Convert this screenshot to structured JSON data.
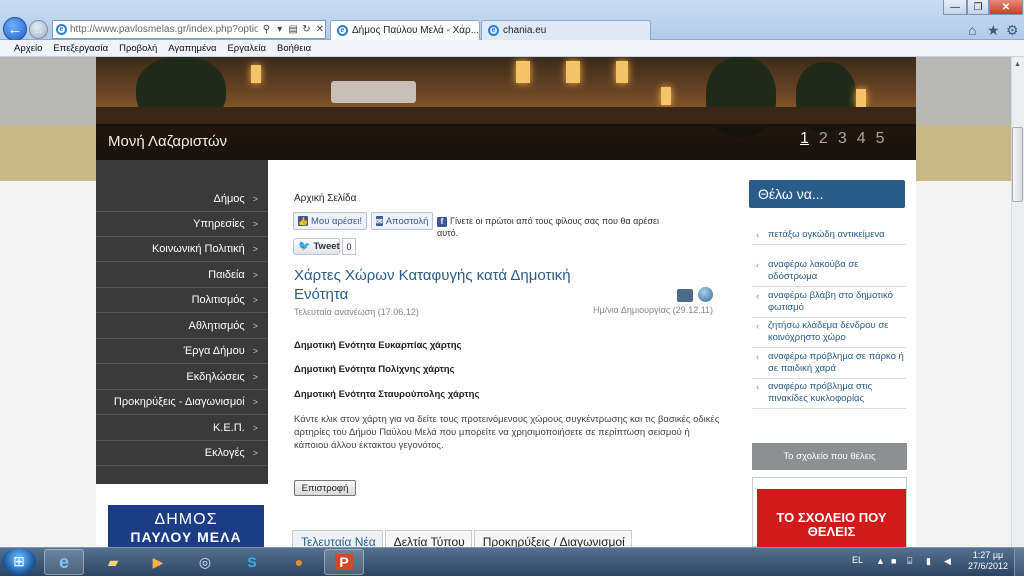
{
  "browser": {
    "address": "http://www.pavlosmelas.gr/index.php?option=c",
    "tabs": [
      {
        "label": "Δήμος Παύλου Μελά - Χάρ..."
      },
      {
        "label": "chania.eu"
      }
    ],
    "menu": [
      "Αρχείο",
      "Επεξεργασία",
      "Προβολή",
      "Αγαπημένα",
      "Εργαλεία",
      "Βοήθεια"
    ]
  },
  "banner": {
    "caption": "Μονή Λαζαριστών",
    "pages": [
      "1",
      "2",
      "3",
      "4",
      "5"
    ],
    "active_page": 1
  },
  "sidebar": {
    "items": [
      "Δήμος",
      "Υπηρεσίες",
      "Κοινωνική Πολιτική",
      "Παιδεία",
      "Πολιτισμός",
      "Αθλητισμός",
      "Έργα Δήμου",
      "Εκδηλώσεις",
      "Προκηρύξεις - Διαγωνισμοί",
      "Κ.Ε.Π.",
      "Εκλογές"
    ],
    "logo_text": "ΔΗΜΟΣ",
    "logo_text2": "ΠΑΥΛΟΥ ΜΕΛΑ"
  },
  "content": {
    "breadcrumb": "Αρχική Σελίδα",
    "like_label": "Μου αρέσει!",
    "send_label": "Αποστολή",
    "fb_note": "Γίνετε οι πρώτοι από τους φίλους σας που θα αρέσει αυτό.",
    "tweet_label": "Tweet",
    "tweet_count": "0",
    "title": "Χάρτες Χώρων Καταφυγής κατά Δημοτική Ενότητα",
    "updated": "Τελευταία ανανέωση (17.06.12)",
    "created": "Ημ/νια Δημιουργίας (29.12.11)",
    "map_links": [
      "Δημοτική Ενότητα Ευκαρπίας χάρτης",
      "Δημοτική Ενότητα Πολίχνης χάρτης",
      "Δημοτική Ενότητα Σταυρούπολης χάρτης"
    ],
    "body": "Κάντε κλικ στον χάρτη για να δείτε τους προτεινόμενους χώρους συγκέντρωσης και τις βασικές οδικές αρτηρίες του Δήμου Παύλου Μελά που μπορείτε να χρησιμοποιήσετε σε περίπτωση σεισμού ή κάποιου άλλου έκτακτου γεγονότος.",
    "back_label": "Επιστροφή",
    "bottom_tabs": [
      "Τελευταία Νέα",
      "Δελτία Τύπου",
      "Προκηρύξεις / Διαγωνισμοί"
    ]
  },
  "right": {
    "want_title": "Θέλω να...",
    "want_items": [
      "πετάξω ογκώδη αντικείμενα",
      "αναφέρω λακούβα σε οδόστρωμα",
      "αναφέρω βλάβη στο δημοτικό φωτισμό",
      "ζητήσω κλάδεμα δένδρου σε κοινόχρηστο χώρο",
      "αναφέρω πρόβλημα σε πάρκο ή σε παιδική χαρά",
      "αναφέρω πρόβλημα στις πινακίδες κυκλοφορίας"
    ],
    "school_title": "Το σχολείο που θέλεις",
    "school_img_text": "ΤΟ ΣΧΟΛΕΙΟ ΠΟΥ ΘΕΛΕΙΣ"
  },
  "taskbar": {
    "lang": "EL",
    "time": "1:27 μμ",
    "date": "27/6/2012"
  },
  "colors": {
    "accent": "#2a5c8a",
    "sidebar": "#3a3a3a",
    "gold": "#c8b885"
  }
}
